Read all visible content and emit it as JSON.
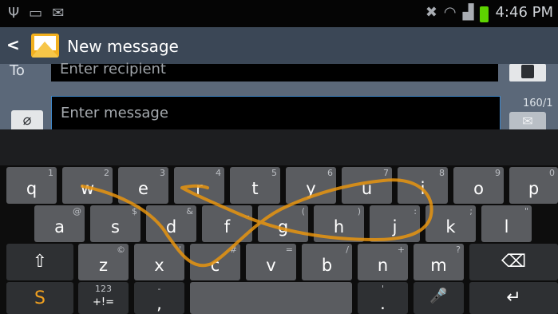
{
  "status_bar": {
    "left_icons": [
      "usb-icon",
      "keyboard-icon",
      "gmail-icon"
    ],
    "right_icons": [
      "mute-icon",
      "wifi-icon",
      "signal-icon",
      "battery-icon"
    ],
    "time": "4:46 PM",
    "battery_color": "#5dd400"
  },
  "action_bar": {
    "back_glyph": "<",
    "title": "New message"
  },
  "compose": {
    "to_label": "To",
    "recipient_placeholder": "Enter recipient",
    "message_placeholder": "Enter message",
    "counter": "160/1",
    "accent_color": "#3e86c8"
  },
  "keyboard": {
    "row1": [
      {
        "label": "q",
        "hint": "1"
      },
      {
        "label": "w",
        "hint": "2"
      },
      {
        "label": "e",
        "hint": "3"
      },
      {
        "label": "r",
        "hint": "4"
      },
      {
        "label": "t",
        "hint": "5"
      },
      {
        "label": "y",
        "hint": "6"
      },
      {
        "label": "u",
        "hint": "7"
      },
      {
        "label": "i",
        "hint": "8"
      },
      {
        "label": "o",
        "hint": "9"
      },
      {
        "label": "p",
        "hint": "0"
      }
    ],
    "row2": [
      {
        "label": "a",
        "hint": "@"
      },
      {
        "label": "s",
        "hint": "$"
      },
      {
        "label": "d",
        "hint": "&"
      },
      {
        "label": "f",
        "hint": "_"
      },
      {
        "label": "g",
        "hint": "("
      },
      {
        "label": "h",
        "hint": ")"
      },
      {
        "label": "j",
        "hint": ":"
      },
      {
        "label": "k",
        "hint": ";"
      },
      {
        "label": "l",
        "hint": "\""
      }
    ],
    "row3": [
      {
        "label": "z",
        "hint": "©"
      },
      {
        "label": "x",
        "hint": "'"
      },
      {
        "label": "c",
        "hint": "#"
      },
      {
        "label": "v",
        "hint": "="
      },
      {
        "label": "b",
        "hint": "/"
      },
      {
        "label": "n",
        "hint": "+"
      },
      {
        "label": "m",
        "hint": "?"
      }
    ],
    "symbols_sub": "123",
    "symbols_label": "+!=",
    "comma_hint": "-",
    "comma_label": ",",
    "period_hint": "'",
    "period_label": ".",
    "shift_glyph": "⇧",
    "delete_glyph": "⌫",
    "mic_glyph": "🎤",
    "enter_glyph": "↵",
    "swype_trace_color": "#e8940f",
    "swype_word_keys": [
      "w",
      "o",
      "r",
      "d"
    ]
  }
}
